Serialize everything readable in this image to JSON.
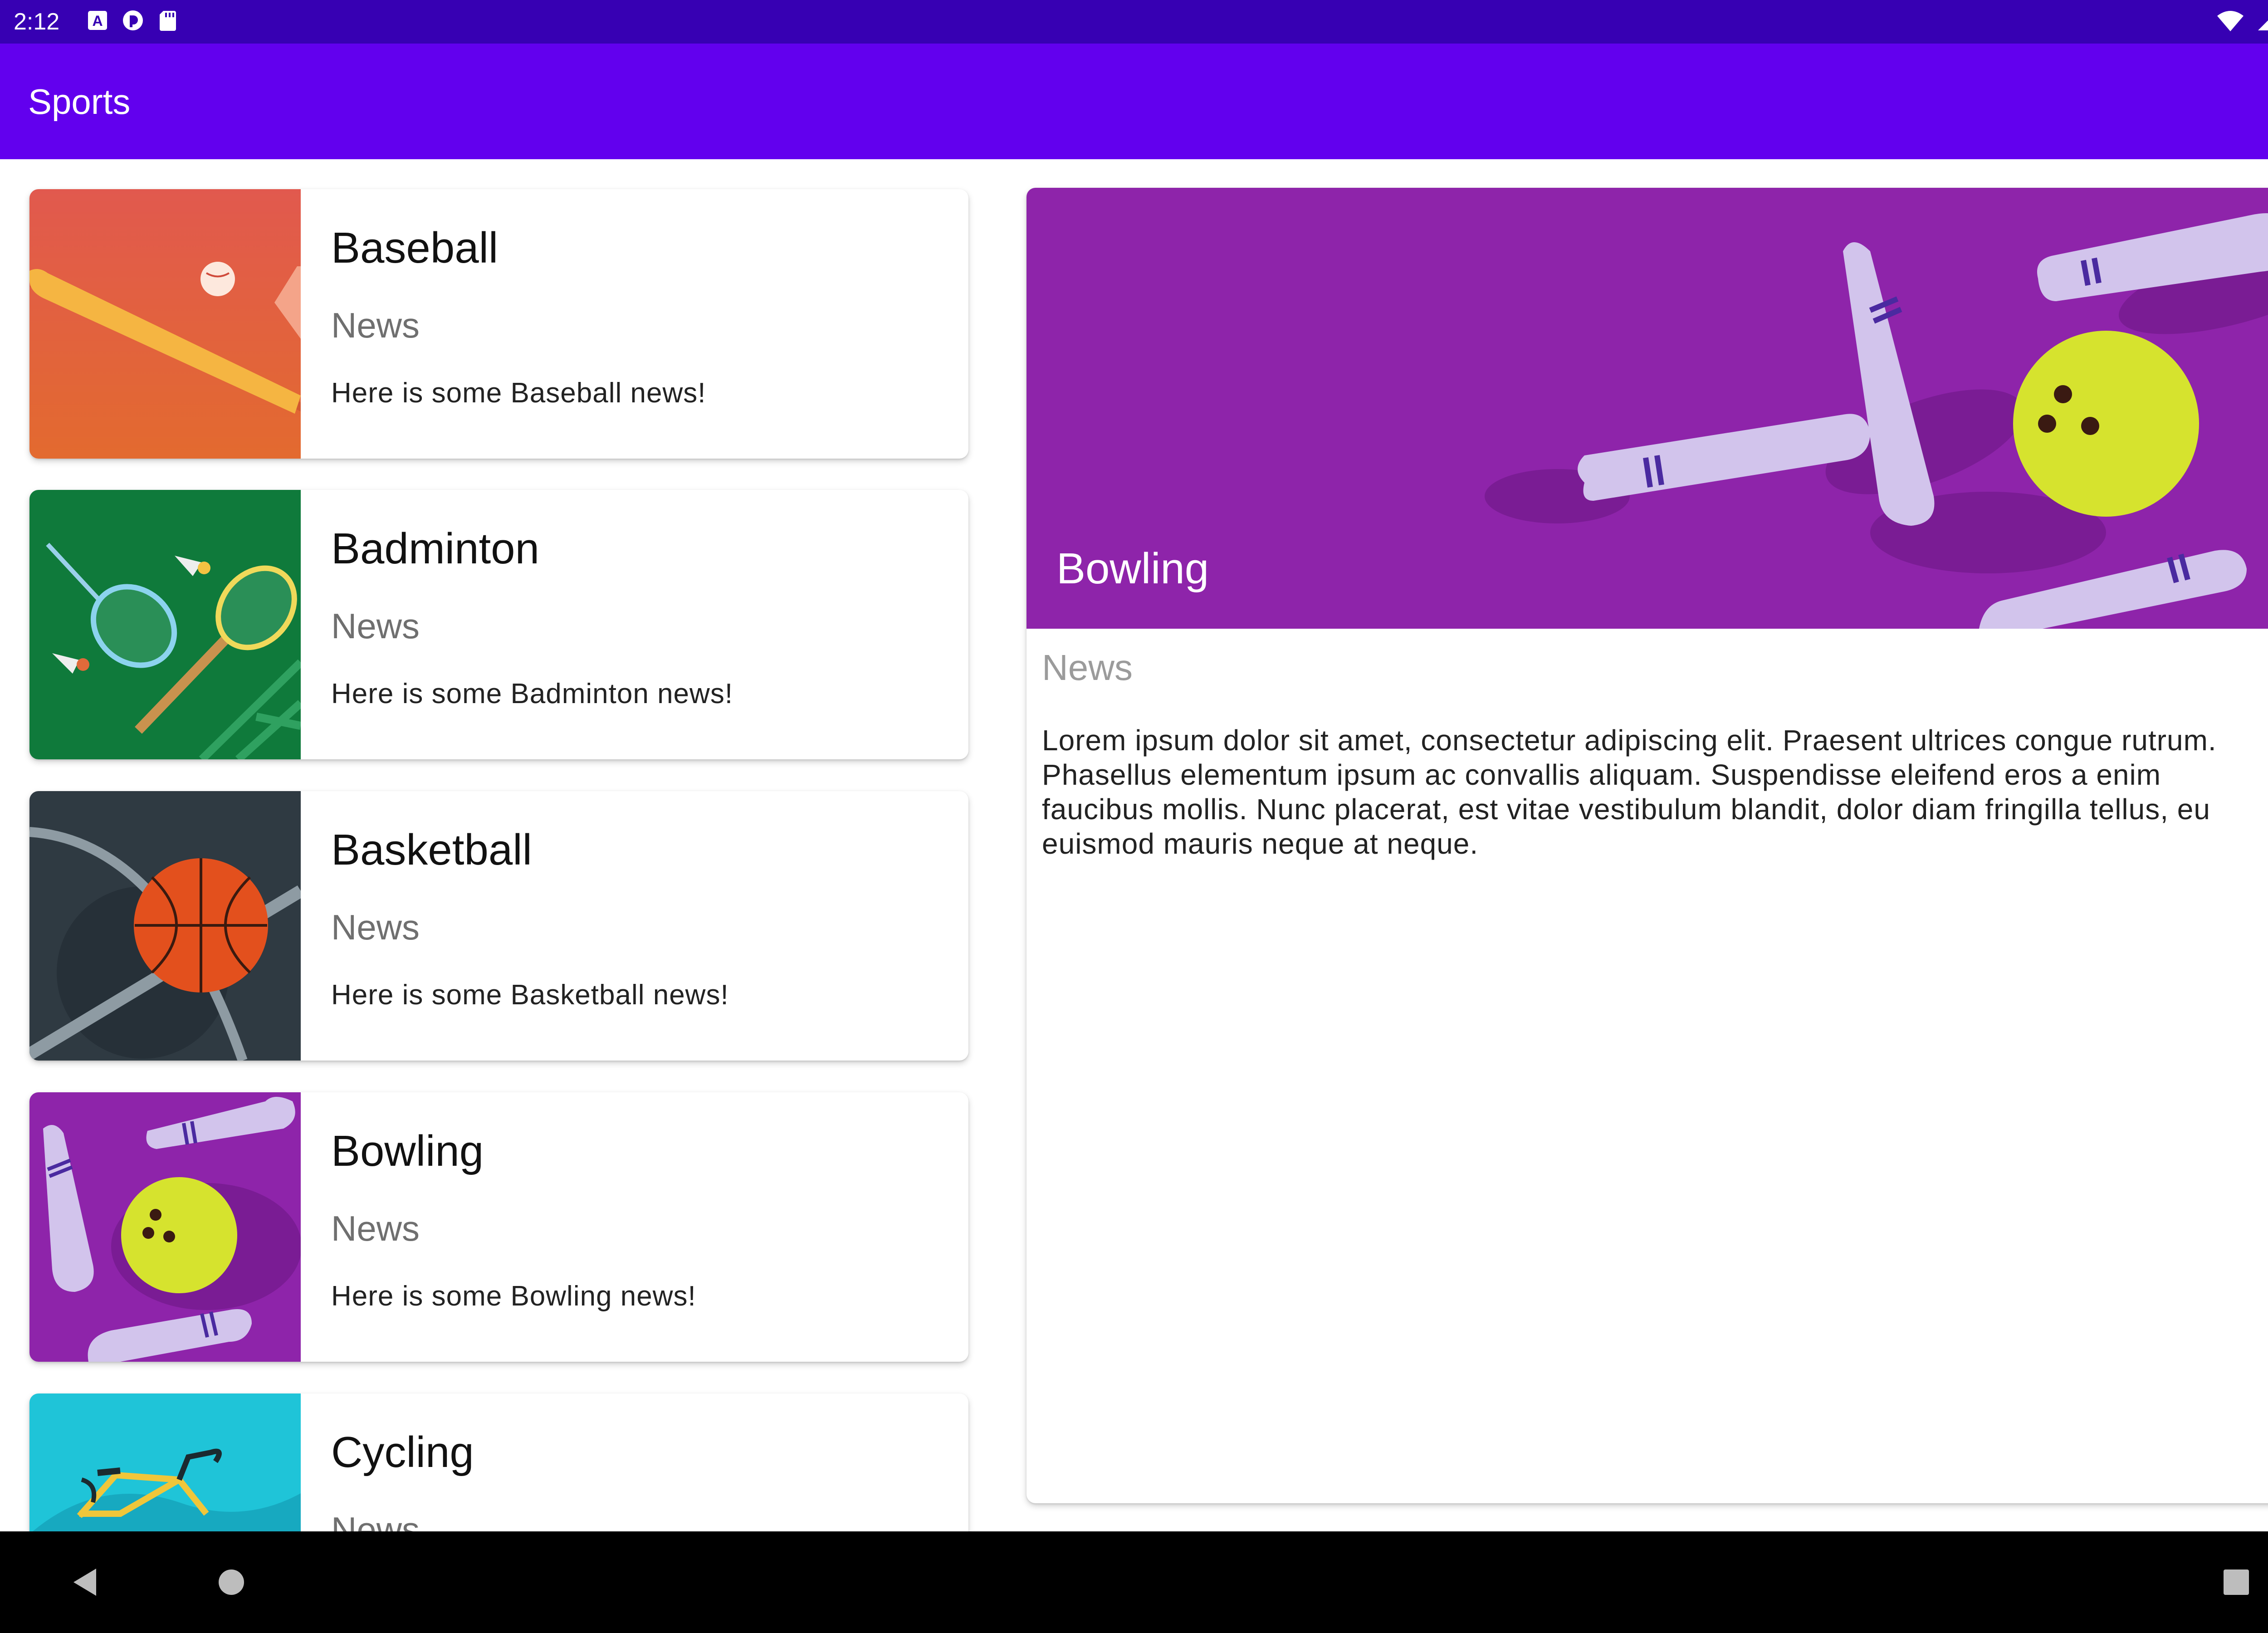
{
  "status_bar": {
    "time": "2:12",
    "left_icons": [
      "a-notification-icon",
      "messenger-icon",
      "sd-card-icon"
    ],
    "right_icons": [
      "wifi-icon",
      "signal-icon",
      "battery-icon"
    ]
  },
  "app_bar": {
    "title": "Sports"
  },
  "sports": [
    {
      "title": "Baseball",
      "subtitle": "News",
      "text": "Here is some Baseball news!",
      "image": "baseball-image",
      "color": "#e1584b"
    },
    {
      "title": "Badminton",
      "subtitle": "News",
      "text": "Here is some Badminton news!",
      "image": "badminton-image",
      "color": "#0f7a3b"
    },
    {
      "title": "Basketball",
      "subtitle": "News",
      "text": "Here is some Basketball news!",
      "image": "basketball-image",
      "color": "#2f3a42"
    },
    {
      "title": "Bowling",
      "subtitle": "News",
      "text": "Here is some Bowling news!",
      "image": "bowling-image",
      "color": "#8e24aa"
    },
    {
      "title": "Cycling",
      "subtitle": "News",
      "text": "",
      "image": "cycling-image",
      "color": "#1fc4d8"
    }
  ],
  "detail": {
    "title": "Bowling",
    "subtitle": "News",
    "body": "Lorem ipsum dolor sit amet, consectetur adipiscing elit. Praesent ultrices congue rutrum. Phasellus elementum ipsum ac convallis aliquam. Suspendisse eleifend eros a enim faucibus mollis. Nunc placerat, est vitae vestibulum blandit, dolor diam fringilla tellus, eu euismod mauris neque at neque.",
    "image": "bowling-hero-image",
    "color": "#8e24aa"
  },
  "nav_bar": {
    "buttons": [
      "back-icon",
      "home-icon",
      "recents-icon"
    ]
  }
}
